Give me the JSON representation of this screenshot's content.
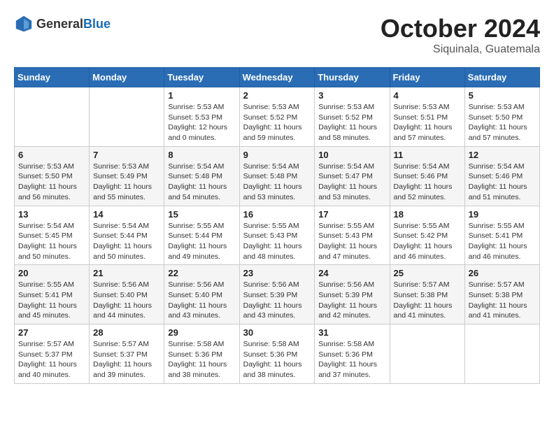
{
  "header": {
    "logo_general": "General",
    "logo_blue": "Blue",
    "month": "October 2024",
    "location": "Siquinala, Guatemala"
  },
  "weekdays": [
    "Sunday",
    "Monday",
    "Tuesday",
    "Wednesday",
    "Thursday",
    "Friday",
    "Saturday"
  ],
  "weeks": [
    [
      {
        "day": "",
        "info": ""
      },
      {
        "day": "",
        "info": ""
      },
      {
        "day": "1",
        "info": "Sunrise: 5:53 AM\nSunset: 5:53 PM\nDaylight: 12 hours\nand 0 minutes."
      },
      {
        "day": "2",
        "info": "Sunrise: 5:53 AM\nSunset: 5:52 PM\nDaylight: 11 hours\nand 59 minutes."
      },
      {
        "day": "3",
        "info": "Sunrise: 5:53 AM\nSunset: 5:52 PM\nDaylight: 11 hours\nand 58 minutes."
      },
      {
        "day": "4",
        "info": "Sunrise: 5:53 AM\nSunset: 5:51 PM\nDaylight: 11 hours\nand 57 minutes."
      },
      {
        "day": "5",
        "info": "Sunrise: 5:53 AM\nSunset: 5:50 PM\nDaylight: 11 hours\nand 57 minutes."
      }
    ],
    [
      {
        "day": "6",
        "info": "Sunrise: 5:53 AM\nSunset: 5:50 PM\nDaylight: 11 hours\nand 56 minutes."
      },
      {
        "day": "7",
        "info": "Sunrise: 5:53 AM\nSunset: 5:49 PM\nDaylight: 11 hours\nand 55 minutes."
      },
      {
        "day": "8",
        "info": "Sunrise: 5:54 AM\nSunset: 5:48 PM\nDaylight: 11 hours\nand 54 minutes."
      },
      {
        "day": "9",
        "info": "Sunrise: 5:54 AM\nSunset: 5:48 PM\nDaylight: 11 hours\nand 53 minutes."
      },
      {
        "day": "10",
        "info": "Sunrise: 5:54 AM\nSunset: 5:47 PM\nDaylight: 11 hours\nand 53 minutes."
      },
      {
        "day": "11",
        "info": "Sunrise: 5:54 AM\nSunset: 5:46 PM\nDaylight: 11 hours\nand 52 minutes."
      },
      {
        "day": "12",
        "info": "Sunrise: 5:54 AM\nSunset: 5:46 PM\nDaylight: 11 hours\nand 51 minutes."
      }
    ],
    [
      {
        "day": "13",
        "info": "Sunrise: 5:54 AM\nSunset: 5:45 PM\nDaylight: 11 hours\nand 50 minutes."
      },
      {
        "day": "14",
        "info": "Sunrise: 5:54 AM\nSunset: 5:44 PM\nDaylight: 11 hours\nand 50 minutes."
      },
      {
        "day": "15",
        "info": "Sunrise: 5:55 AM\nSunset: 5:44 PM\nDaylight: 11 hours\nand 49 minutes."
      },
      {
        "day": "16",
        "info": "Sunrise: 5:55 AM\nSunset: 5:43 PM\nDaylight: 11 hours\nand 48 minutes."
      },
      {
        "day": "17",
        "info": "Sunrise: 5:55 AM\nSunset: 5:43 PM\nDaylight: 11 hours\nand 47 minutes."
      },
      {
        "day": "18",
        "info": "Sunrise: 5:55 AM\nSunset: 5:42 PM\nDaylight: 11 hours\nand 46 minutes."
      },
      {
        "day": "19",
        "info": "Sunrise: 5:55 AM\nSunset: 5:41 PM\nDaylight: 11 hours\nand 46 minutes."
      }
    ],
    [
      {
        "day": "20",
        "info": "Sunrise: 5:55 AM\nSunset: 5:41 PM\nDaylight: 11 hours\nand 45 minutes."
      },
      {
        "day": "21",
        "info": "Sunrise: 5:56 AM\nSunset: 5:40 PM\nDaylight: 11 hours\nand 44 minutes."
      },
      {
        "day": "22",
        "info": "Sunrise: 5:56 AM\nSunset: 5:40 PM\nDaylight: 11 hours\nand 43 minutes."
      },
      {
        "day": "23",
        "info": "Sunrise: 5:56 AM\nSunset: 5:39 PM\nDaylight: 11 hours\nand 43 minutes."
      },
      {
        "day": "24",
        "info": "Sunrise: 5:56 AM\nSunset: 5:39 PM\nDaylight: 11 hours\nand 42 minutes."
      },
      {
        "day": "25",
        "info": "Sunrise: 5:57 AM\nSunset: 5:38 PM\nDaylight: 11 hours\nand 41 minutes."
      },
      {
        "day": "26",
        "info": "Sunrise: 5:57 AM\nSunset: 5:38 PM\nDaylight: 11 hours\nand 41 minutes."
      }
    ],
    [
      {
        "day": "27",
        "info": "Sunrise: 5:57 AM\nSunset: 5:37 PM\nDaylight: 11 hours\nand 40 minutes."
      },
      {
        "day": "28",
        "info": "Sunrise: 5:57 AM\nSunset: 5:37 PM\nDaylight: 11 hours\nand 39 minutes."
      },
      {
        "day": "29",
        "info": "Sunrise: 5:58 AM\nSunset: 5:36 PM\nDaylight: 11 hours\nand 38 minutes."
      },
      {
        "day": "30",
        "info": "Sunrise: 5:58 AM\nSunset: 5:36 PM\nDaylight: 11 hours\nand 38 minutes."
      },
      {
        "day": "31",
        "info": "Sunrise: 5:58 AM\nSunset: 5:36 PM\nDaylight: 11 hours\nand 37 minutes."
      },
      {
        "day": "",
        "info": ""
      },
      {
        "day": "",
        "info": ""
      }
    ]
  ]
}
